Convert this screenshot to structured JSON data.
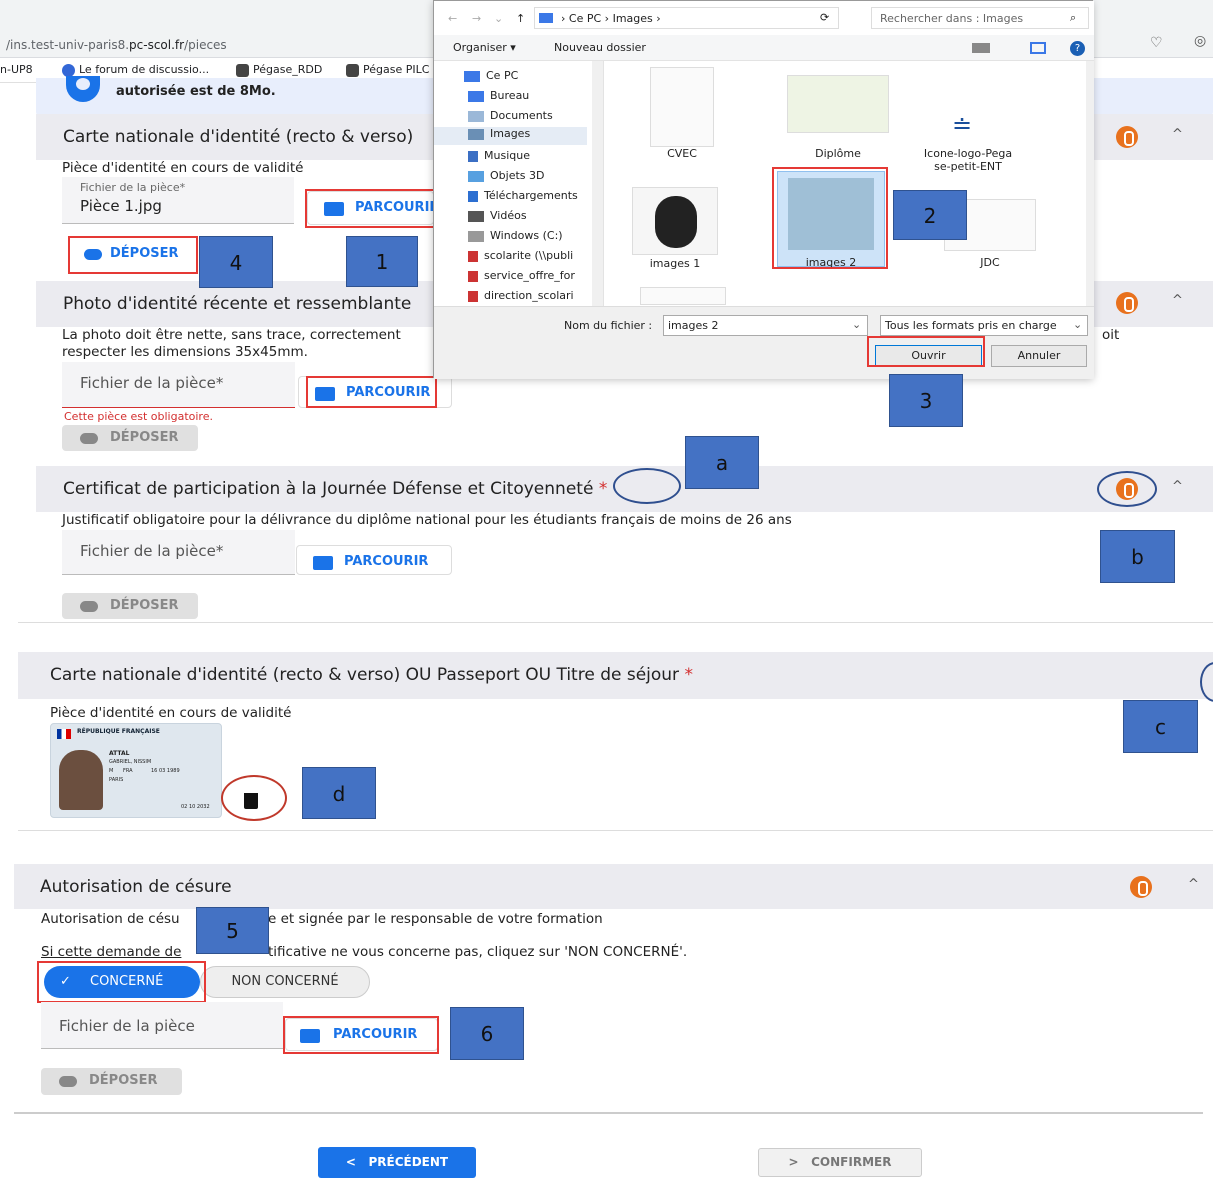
{
  "browser": {
    "url_prefix": "/ins.test-univ-paris8.",
    "url_domain": "pc-scol.fr",
    "url_path": "/pieces",
    "bookmarks": [
      "n-UP8",
      "Le forum de discussio...",
      "Pégase_RDD",
      "Pégase PILC"
    ]
  },
  "banner": {
    "text": "autorisée est de 8Mo."
  },
  "sections": {
    "cni": {
      "title": "Carte nationale d'identité (recto & verso)",
      "desc": "Pièce d'identité en cours de validité",
      "field_label": "Fichier de la pièce*",
      "field_value": "Pièce 1.jpg",
      "browse": "PARCOURIR",
      "depose": "DÉPOSER"
    },
    "photo": {
      "title": "Photo d'identité récente et ressemblante",
      "desc1": "La photo doit être nette, sans trace, correctement",
      "desc2": "respecter les dimensions 35x45mm.",
      "desc_right": "oit",
      "field_label": "Fichier de la pièce*",
      "error": "Cette pièce est obligatoire.",
      "browse": "PARCOURIR",
      "depose": "DÉPOSER"
    },
    "jdc": {
      "title": "Certificat de participation à la Journée Défense et Citoyenneté",
      "desc": "Justificatif obligatoire pour la délivrance du diplôme national pour les étudiants français de moins de 26 ans",
      "field_label": "Fichier de la pièce*",
      "browse": "PARCOURIR",
      "depose": "DÉPOSER"
    },
    "cni_full": {
      "title": "Carte nationale d'identité (recto & verso) OU Passeport OU Titre de séjour",
      "desc": "Pièce d'identité en cours de validité",
      "card_header": "RÉPUBLIQUE FRANÇAISE",
      "card_surname": "ATTAL",
      "card_given": "GABRIEL, NISSIM",
      "card_sex": "M",
      "card_nat": "FRA",
      "card_birth": "16 03 1989",
      "card_place": "PARIS",
      "card_expiry": "02 10 2032"
    },
    "cesure": {
      "title": "Autorisation de césure",
      "desc1a": "Autorisation de césu",
      "desc1b": "e et signée par le responsable de votre formation",
      "desc2a": "Si cette demande de",
      "desc2b": "tificative ne vous concerne pas, cliquez sur 'NON CONCERNÉ'.",
      "btn_concerne": "CONCERNÉ",
      "btn_non_concerne": "NON CONCERNÉ",
      "field_label": "Fichier de la pièce",
      "browse": "PARCOURIR",
      "depose": "DÉPOSER"
    }
  },
  "dialog": {
    "breadcrumb": [
      "Ce PC",
      "Images"
    ],
    "search_placeholder": "Rechercher dans : Images",
    "organiser": "Organiser ▾",
    "nouveau": "Nouveau dossier",
    "nav": [
      "Ce PC",
      "Bureau",
      "Documents",
      "Images",
      "Musique",
      "Objets 3D",
      "Téléchargements",
      "Vidéos",
      "Windows (C:)",
      "scolarite (\\\\publi",
      "service_offre_for",
      "direction_scolari"
    ],
    "files": [
      "CVEC",
      "Diplôme",
      "Icone-logo-Pega se-petit-ENT",
      "images 1",
      "images 2",
      "JDC"
    ],
    "filename_label": "Nom du fichier :",
    "filename_value": "images 2",
    "filter": "Tous les formats pris en charge",
    "open": "Ouvrir",
    "cancel": "Annuler"
  },
  "markers": [
    "1",
    "2",
    "3",
    "4",
    "5",
    "6",
    "a",
    "b",
    "c",
    "d"
  ],
  "footer": {
    "prev": "PRÉCÉDENT",
    "confirm": "CONFIRMER",
    "prev_icon": "<",
    "confirm_icon": ">"
  },
  "colors": {
    "accent": "#1a73e8",
    "clip": "#e8711d",
    "marker": "#4472c4",
    "highlight": "#e53935"
  }
}
